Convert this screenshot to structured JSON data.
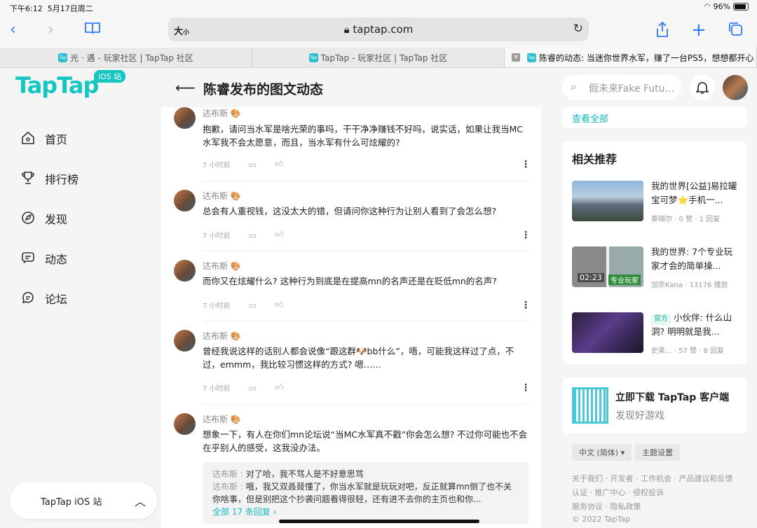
{
  "status": {
    "time": "下午6:12",
    "date": "5月17日周二",
    "battery": "96%"
  },
  "browser": {
    "text_size": "大",
    "text_size_small": "小",
    "url": "taptap.com",
    "tabs": [
      {
        "title": "光 · 遇 - 玩家社区 | TapTap 社区"
      },
      {
        "title": "TapTap - 玩家社区 | TapTap 社区"
      },
      {
        "title": "陈睿的动态: 当迷你世界水军，赚了一台PS5，想想都开心 |..."
      }
    ]
  },
  "sidebar": {
    "logo": "TapTap",
    "badge": "iOS 站",
    "nav": [
      {
        "label": "首页"
      },
      {
        "label": "排行榜"
      },
      {
        "label": "发现"
      },
      {
        "label": "动态"
      },
      {
        "label": "论坛"
      }
    ],
    "ios_card": "TapTap iOS 站"
  },
  "main": {
    "title": "陈睿发布的图文动态",
    "comments": [
      {
        "user": "达布斯",
        "text": "抱歉，请问当水军是啥光荣的事吗，干干净净赚钱不好吗，说实话，如果让我当MC水军我不会太愿意，而且，当水军有什么可炫耀的?",
        "time": "7 小时前"
      },
      {
        "user": "达布斯",
        "text": "总会有人重视钱，这没太大的错，但请问你这种行为让别人看到了会怎么想?",
        "time": "7 小时前"
      },
      {
        "user": "达布斯",
        "text": "而你又在炫耀什么? 这种行为到底是在提高mn的名声还是在贬低mn的名声?",
        "time": "7 小时前"
      },
      {
        "user": "达布斯",
        "text": "曾经我说这样的话别人都会说像“跟这群🐶bb什么”，唔，可能我这样过了点，不过，emmm，我比较习惯这样的方式? 嗯……",
        "time": "7 小时前"
      },
      {
        "user": "达布斯",
        "text": "想象一下，有人在你们mn论坛说“当MC水军真不戳”你会怎么想? 不过你可能也不会在乎别人的感受，这我没办法。",
        "time": ""
      }
    ],
    "replies": [
      {
        "who": "达布斯 :",
        "text": "对了哈，我不骂人是不好意思骂"
      },
      {
        "who": "达布斯 :",
        "text": "哦，我又双叒叕懂了，你当水军就是玩玩对吧，反正就算mn倒了也不关你啥事，但是别把这个抄袭问题看得很轻，还有进不去你的主页也和你..."
      }
    ],
    "replies_more": "全部 17 条回复 ›"
  },
  "right": {
    "search_placeholder": "假未来Fake Futu...",
    "view_all": "查看全部",
    "rec_title": "相关推荐",
    "recs": [
      {
        "title": "我的世界[公益]易拉罐宝可梦⭐手机一...",
        "meta": "泰瑞尔 · 0 赞 · 1 回复",
        "tag": ""
      },
      {
        "title": "我的世界: 7个专业玩家才会的简单操...",
        "meta": "加奈Kana · 13176 播放",
        "tag": "",
        "duration": "02:23",
        "overlay": "专业玩家"
      },
      {
        "title": "小伙伴: 什么山洞? 明明就是我...",
        "meta": "史莱...    · 57 赞 · 8 回复",
        "tag": "官方"
      }
    ],
    "download_title": "立即下载 TapTap 客户端",
    "download_sub": "发现好游戏",
    "lang": "中文 (简体) ▾",
    "theme": "主题设置",
    "footer": [
      "关于我们 · 开发者 · 工作机会 · 产品建议和反馈",
      "认证 · 推广中心 · 侵权投诉",
      "服务协议 · 隐私政策",
      "© 2022 TapTap"
    ]
  }
}
